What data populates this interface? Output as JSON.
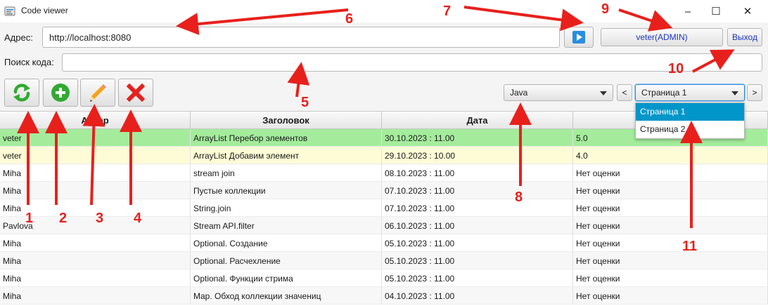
{
  "window": {
    "title": "Code viewer",
    "controls": {
      "minimize": "–",
      "maximize": "☐",
      "close": "✕"
    }
  },
  "address": {
    "label": "Адрес:",
    "value": "http://localhost:8080"
  },
  "user": {
    "label": "veter(ADMIN)",
    "exit_label": "Выход"
  },
  "search": {
    "label": "Поиск кода:",
    "value": ""
  },
  "toolbar": {
    "refresh_icon": "refresh-icon",
    "add_icon": "add-icon",
    "edit_icon": "pencil-icon",
    "delete_icon": "delete-icon"
  },
  "language": {
    "selected": "Java"
  },
  "pagination": {
    "prev": "<",
    "next": ">",
    "selected": "Страница 1",
    "options": [
      "Страница 1",
      "Страница 2"
    ]
  },
  "table": {
    "columns": [
      "Автор",
      "Заголовок",
      "Дата",
      ""
    ],
    "rows": [
      {
        "author": "veter",
        "title": "ArrayList Перебор элементов",
        "date": "30.10.2023 : 11.00",
        "rating": "5.0"
      },
      {
        "author": "veter",
        "title": "ArrayList Добавим элемент",
        "date": "29.10.2023 : 10.00",
        "rating": "4.0"
      },
      {
        "author": "Miha",
        "title": "stream join",
        "date": "08.10.2023 : 11.00",
        "rating": "Нет оценки"
      },
      {
        "author": "Miha",
        "title": "Пустые коллекции",
        "date": "07.10.2023 : 11.00",
        "rating": "Нет оценки"
      },
      {
        "author": "Miha",
        "title": "String.join",
        "date": "07.10.2023 : 11.00",
        "rating": "Нет оценки"
      },
      {
        "author": "Pavlova",
        "title": "Stream API.filter",
        "date": "06.10.2023 : 11.00",
        "rating": "Нет оценки"
      },
      {
        "author": "Miha",
        "title": "Optional. Создание",
        "date": "05.10.2023 : 11.00",
        "rating": "Нет оценки"
      },
      {
        "author": "Miha",
        "title": "Optional. Расчехление",
        "date": "05.10.2023 : 11.00",
        "rating": "Нет оценки"
      },
      {
        "author": "Miha",
        "title": "Optional. Функции стрима",
        "date": "05.10.2023 : 11.00",
        "rating": "Нет оценки"
      },
      {
        "author": "Miha",
        "title": "Map. Обход коллекции значениц",
        "date": "04.10.2023 : 11.00",
        "rating": "Нет оценки"
      }
    ],
    "row_colors": [
      "#a4ec9c",
      "#fefcd6"
    ]
  },
  "annotations": {
    "color": "#e8201c",
    "labels": [
      "1",
      "2",
      "3",
      "4",
      "5",
      "6",
      "7",
      "8",
      "9",
      "10",
      "11"
    ]
  },
  "colors": {
    "accent": "#0096c9",
    "link": "#1a33c9",
    "play": "#2a8de0"
  }
}
